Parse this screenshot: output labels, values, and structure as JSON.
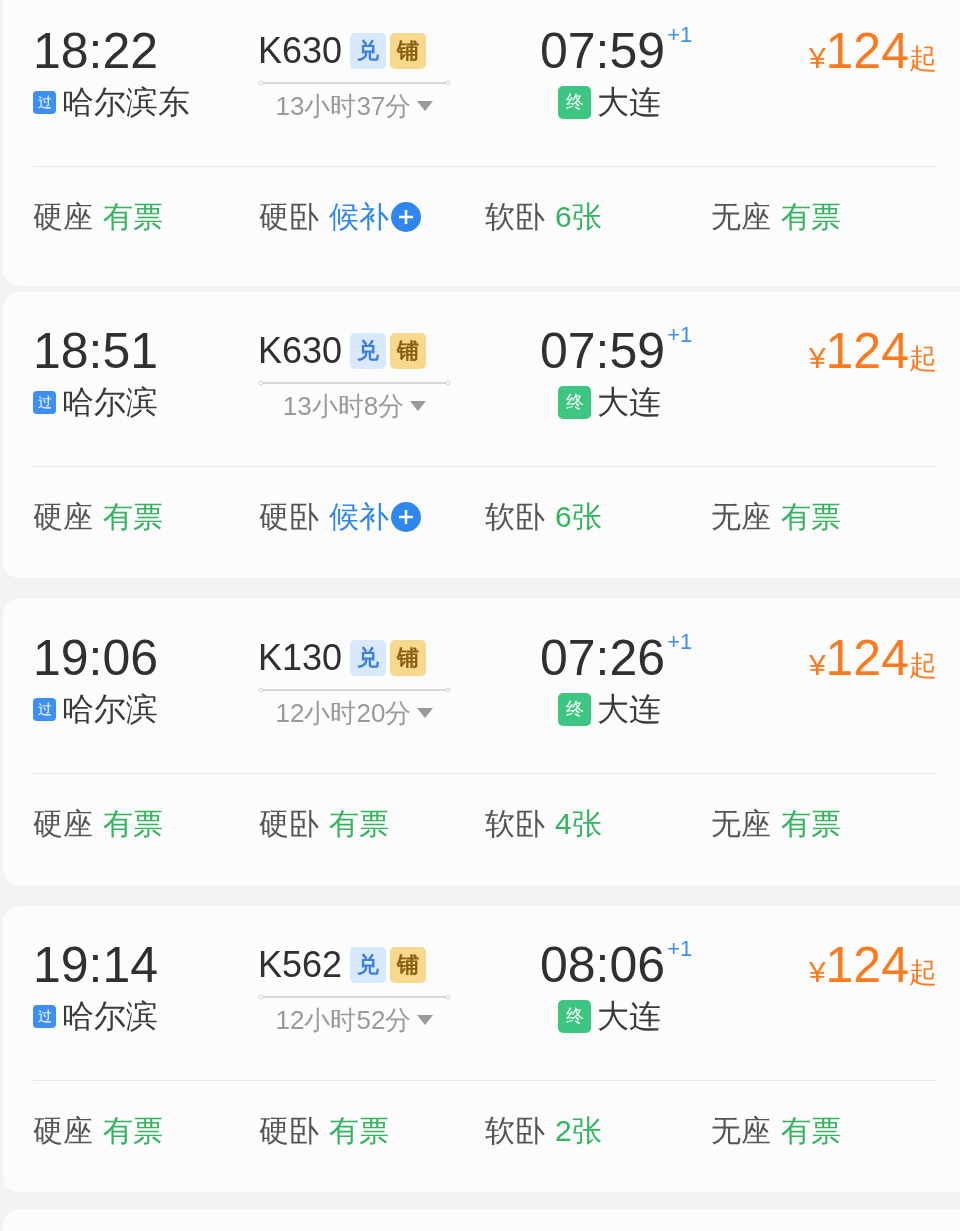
{
  "trains": [
    {
      "depart_time": "18:22",
      "depart_tag": "过",
      "depart_station": "哈尔滨东",
      "number": "K630",
      "badges": [
        {
          "text": "兑",
          "kind": "exchange"
        },
        {
          "text": "铺",
          "kind": "berth"
        }
      ],
      "duration": "13小时37分",
      "arrive_time": "07:59",
      "day_offset": "+1",
      "arrive_tag": "终",
      "arrive_station": "大连",
      "currency": "¥",
      "price": "124",
      "price_suffix": "起",
      "seats": [
        {
          "name": "硬座",
          "status": "有票",
          "kind": "available"
        },
        {
          "name": "硬卧",
          "status": "候补",
          "kind": "waitlist"
        },
        {
          "name": "软卧",
          "status": "6张",
          "kind": "available"
        },
        {
          "name": "无座",
          "status": "有票",
          "kind": "available"
        }
      ]
    },
    {
      "depart_time": "18:51",
      "depart_tag": "过",
      "depart_station": "哈尔滨",
      "number": "K630",
      "badges": [
        {
          "text": "兑",
          "kind": "exchange"
        },
        {
          "text": "铺",
          "kind": "berth"
        }
      ],
      "duration": "13小时8分",
      "arrive_time": "07:59",
      "day_offset": "+1",
      "arrive_tag": "终",
      "arrive_station": "大连",
      "currency": "¥",
      "price": "124",
      "price_suffix": "起",
      "seats": [
        {
          "name": "硬座",
          "status": "有票",
          "kind": "available"
        },
        {
          "name": "硬卧",
          "status": "候补",
          "kind": "waitlist"
        },
        {
          "name": "软卧",
          "status": "6张",
          "kind": "available"
        },
        {
          "name": "无座",
          "status": "有票",
          "kind": "available"
        }
      ]
    },
    {
      "depart_time": "19:06",
      "depart_tag": "过",
      "depart_station": "哈尔滨",
      "number": "K130",
      "badges": [
        {
          "text": "兑",
          "kind": "exchange"
        },
        {
          "text": "铺",
          "kind": "berth"
        }
      ],
      "duration": "12小时20分",
      "arrive_time": "07:26",
      "day_offset": "+1",
      "arrive_tag": "终",
      "arrive_station": "大连",
      "currency": "¥",
      "price": "124",
      "price_suffix": "起",
      "seats": [
        {
          "name": "硬座",
          "status": "有票",
          "kind": "available"
        },
        {
          "name": "硬卧",
          "status": "有票",
          "kind": "available"
        },
        {
          "name": "软卧",
          "status": "4张",
          "kind": "available"
        },
        {
          "name": "无座",
          "status": "有票",
          "kind": "available"
        }
      ]
    },
    {
      "depart_time": "19:14",
      "depart_tag": "过",
      "depart_station": "哈尔滨",
      "number": "K562",
      "badges": [
        {
          "text": "兑",
          "kind": "exchange"
        },
        {
          "text": "铺",
          "kind": "berth"
        }
      ],
      "duration": "12小时52分",
      "arrive_time": "08:06",
      "day_offset": "+1",
      "arrive_tag": "终",
      "arrive_station": "大连",
      "currency": "¥",
      "price": "124",
      "price_suffix": "起",
      "seats": [
        {
          "name": "硬座",
          "status": "有票",
          "kind": "available"
        },
        {
          "name": "硬卧",
          "status": "有票",
          "kind": "available"
        },
        {
          "name": "软卧",
          "status": "2张",
          "kind": "available"
        },
        {
          "name": "无座",
          "status": "有票",
          "kind": "available"
        }
      ]
    }
  ]
}
